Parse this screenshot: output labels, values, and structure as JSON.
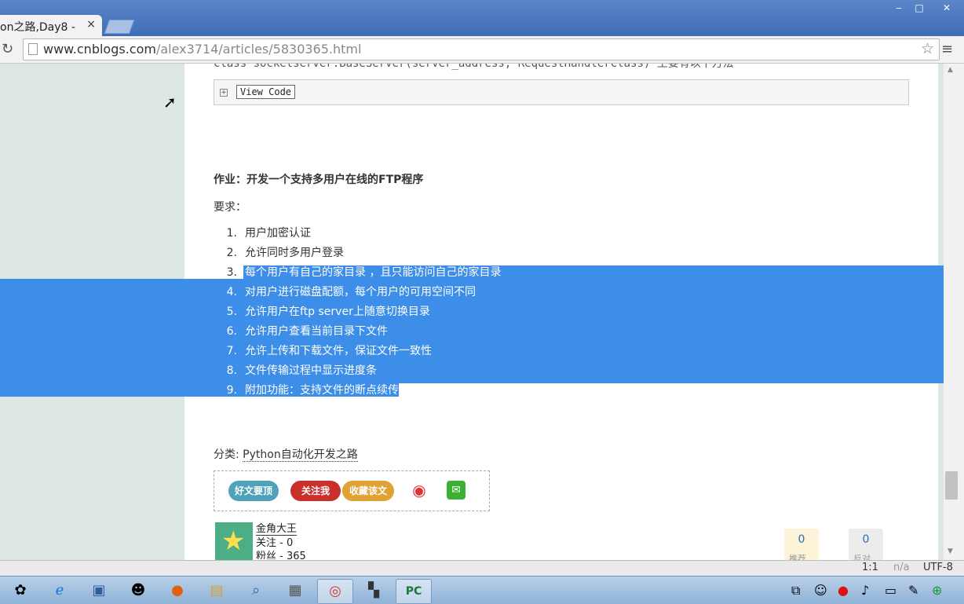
{
  "browser": {
    "tab_title": "on之路,Day8 - ",
    "tab_close": "×",
    "url_host": "www.cnblogs.com",
    "url_path": "/alex3714/articles/5830365.html",
    "window_controls": [
      "‒",
      "□",
      "✕"
    ]
  },
  "article": {
    "cut_line": "class socketserver.BaseServer(server_address, RequestHandlerClass) 主要有以下方法",
    "view_code_label": "View Code",
    "expand_symbol": "+",
    "homework_title": "作业：开发一个支持多用户在线的FTP程序",
    "requirements_label": "要求：",
    "requirements": [
      {
        "num": "1.",
        "text": "用户加密认证"
      },
      {
        "num": "2.",
        "text": "允许同时多用户登录"
      },
      {
        "num": "3.",
        "text": "每个用户有自己的家目录 ，且只能访问自己的家目录"
      },
      {
        "num": "4.",
        "text": "对用户进行磁盘配额，每个用户的可用空间不同"
      },
      {
        "num": "5.",
        "text": "允许用户在ftp server上随意切换目录"
      },
      {
        "num": "6.",
        "text": "允许用户查看当前目录下文件"
      },
      {
        "num": "7.",
        "text": "允许上传和下载文件，保证文件一致性"
      },
      {
        "num": "8.",
        "text": "文件传输过程中显示进度条"
      },
      {
        "num": "9.",
        "text": "附加功能：支持文件的断点续传"
      }
    ],
    "category_label": "分类: ",
    "category_link": "Python自动化开发之路"
  },
  "actions": {
    "good_article": "好文要顶",
    "follow_me": "关注我",
    "favorite": "收藏该文"
  },
  "author": {
    "name": "金角大王",
    "follow": "关注 - 0",
    "fans": "粉丝 - 365"
  },
  "votes": {
    "up_count": "0",
    "up_label": "推荐",
    "down_count": "0",
    "down_label": "反对"
  },
  "status": {
    "zoom": "1:1",
    "na": "n/a",
    "encoding": "UTF-8"
  },
  "colors": {
    "selection": "#3d8ee8",
    "titlebar": "#4f7cc2"
  }
}
